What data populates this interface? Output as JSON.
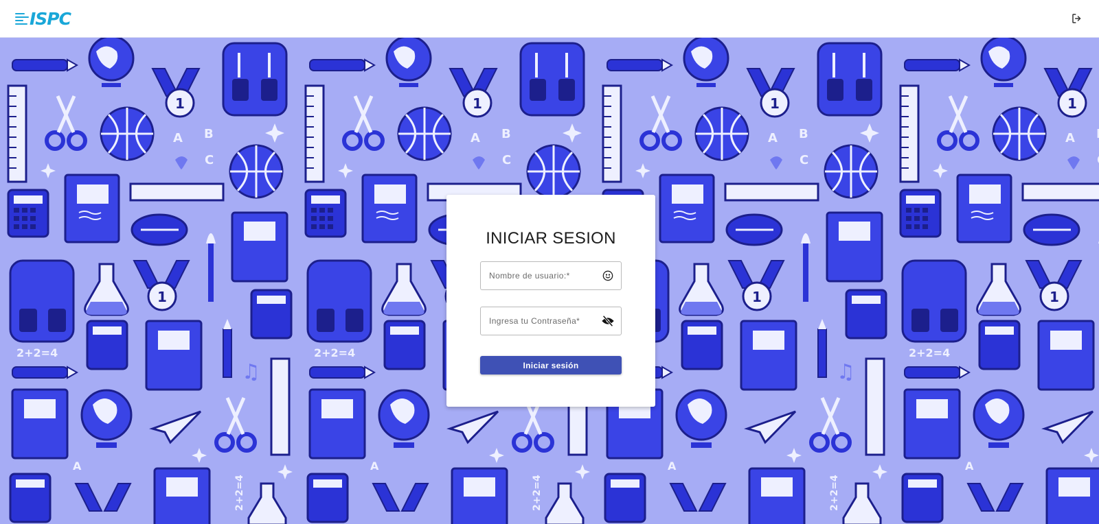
{
  "app": {
    "logo_text": "ISPC"
  },
  "header": {
    "logout_icon": "logout-icon"
  },
  "login": {
    "title": "INICIAR SESION",
    "username_placeholder": "Nombre de usuario:*",
    "username_icon": "smiley-icon",
    "password_placeholder": "Ingresa tu Contraseña*",
    "password_icon": "eye-off-icon",
    "submit_label": "Iniciar sesión"
  },
  "background": {
    "pattern": "school supplies illustration",
    "equation": "2+2=4",
    "letters": [
      "A",
      "B",
      "C"
    ],
    "medal_number": "1"
  },
  "colors": {
    "background": "#a6acf5",
    "primary_button": "#3f51b5",
    "logo": "#1aa7d8",
    "illustration_dark": "#2b33d6"
  }
}
